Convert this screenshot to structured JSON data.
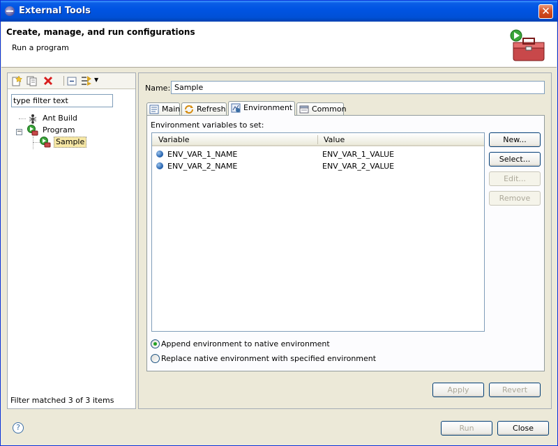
{
  "window": {
    "title": "External Tools"
  },
  "header": {
    "title": "Create, manage, and run configurations",
    "subtitle": "Run a program",
    "icon": "external-tools-toolbox-icon"
  },
  "left": {
    "toolbar_icons": [
      "new-launch-config-icon",
      "duplicate-icon",
      "delete-icon",
      "collapse-all-icon",
      "filter-icon",
      "dropdown-arrow-icon"
    ],
    "filter_placeholder": "type filter text",
    "filter_value": "type filter text",
    "tree": [
      {
        "label": "Ant Build",
        "icon": "ant-icon"
      },
      {
        "label": "Program",
        "icon": "program-icon"
      },
      {
        "label": "Sample",
        "icon": "program-icon",
        "selected": true
      }
    ],
    "status": "Filter matched 3 of 3 items"
  },
  "config": {
    "name_label": "Name:",
    "name_value": "Sample",
    "tabs": [
      {
        "label": "Main",
        "icon": "main-tab-icon"
      },
      {
        "label": "Refresh",
        "icon": "refresh-icon"
      },
      {
        "label": "Environment",
        "icon": "environment-icon",
        "active": true
      },
      {
        "label": "Common",
        "icon": "common-icon"
      }
    ],
    "env_label": "Environment variables to set:",
    "columns": [
      "Variable",
      "Value"
    ],
    "rows": [
      {
        "variable": "ENV_VAR_1_NAME",
        "value": "ENV_VAR_1_VALUE"
      },
      {
        "variable": "ENV_VAR_2_NAME",
        "value": "ENV_VAR_2_VALUE"
      }
    ],
    "buttons": {
      "new": "New...",
      "select": "Select...",
      "edit": "Edit...",
      "remove": "Remove"
    },
    "radio_append": "Append environment to native environment",
    "radio_replace": "Replace native environment with specified environment",
    "apply": "Apply",
    "revert": "Revert"
  },
  "footer": {
    "help": "?",
    "run": "Run",
    "close": "Close"
  },
  "colors": {
    "accent": "#0054e3",
    "selection": "#f7e8a5",
    "dialog": "#ece9d8"
  }
}
